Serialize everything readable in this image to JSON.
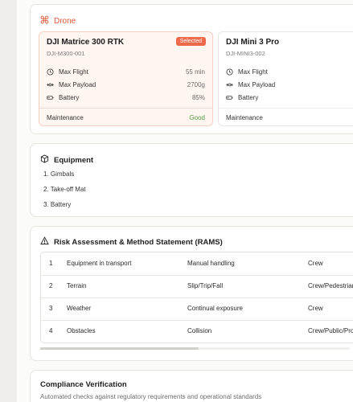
{
  "drone_section": {
    "title": "Drone",
    "icon": "drone-icon",
    "accent": "#e0583b",
    "cards": [
      {
        "name": "DJI Matrice 300 RTK",
        "code": "DJI-M300-001",
        "badge": "Selected",
        "specs": [
          {
            "label": "Max Flight",
            "value": "55 min",
            "icon": "clock-icon"
          },
          {
            "label": "Max Payload",
            "value": "2700g",
            "icon": "payload-icon"
          },
          {
            "label": "Battery",
            "value": "85%",
            "icon": "battery-icon"
          }
        ],
        "maintenance_label": "Maintenance",
        "maintenance_value": "Good"
      },
      {
        "name": "DJI Mini 3 Pro",
        "code": "DJI-MINI3-002",
        "specs": [
          {
            "label": "Max Flight",
            "icon": "clock-icon"
          },
          {
            "label": "Max Payload",
            "icon": "payload-icon"
          },
          {
            "label": "Battery",
            "icon": "battery-icon"
          }
        ],
        "maintenance_label": "Maintenance"
      }
    ]
  },
  "equipment": {
    "title": "Equipment",
    "icon": "box-icon",
    "items": [
      "1. Gimbals",
      "2. Take-off Mat",
      "3. Battery"
    ]
  },
  "rams": {
    "title": "Risk Assessment & Method Statement (RAMS)",
    "icon": "warning-icon",
    "rows": [
      {
        "num": "1",
        "hazard": "Equipment in transport",
        "risk": "Manual handling",
        "who": "Crew"
      },
      {
        "num": "2",
        "hazard": "Terrain",
        "risk": "Slip/Trip/Fall",
        "who": "Crew/Pedestrian"
      },
      {
        "num": "3",
        "hazard": "Weather",
        "risk": "Continual exposure",
        "who": "Crew"
      },
      {
        "num": "4",
        "hazard": "Obstacles",
        "risk": "Collision",
        "who": "Crew/Public/Prop"
      }
    ]
  },
  "compliance": {
    "title": "Compliance Verification",
    "subtitle": "Automated checks against regulatory requirements and operational standards"
  },
  "colors": {
    "selected_badge": "#ee6a4b",
    "good_status": "#4f9a3a"
  }
}
